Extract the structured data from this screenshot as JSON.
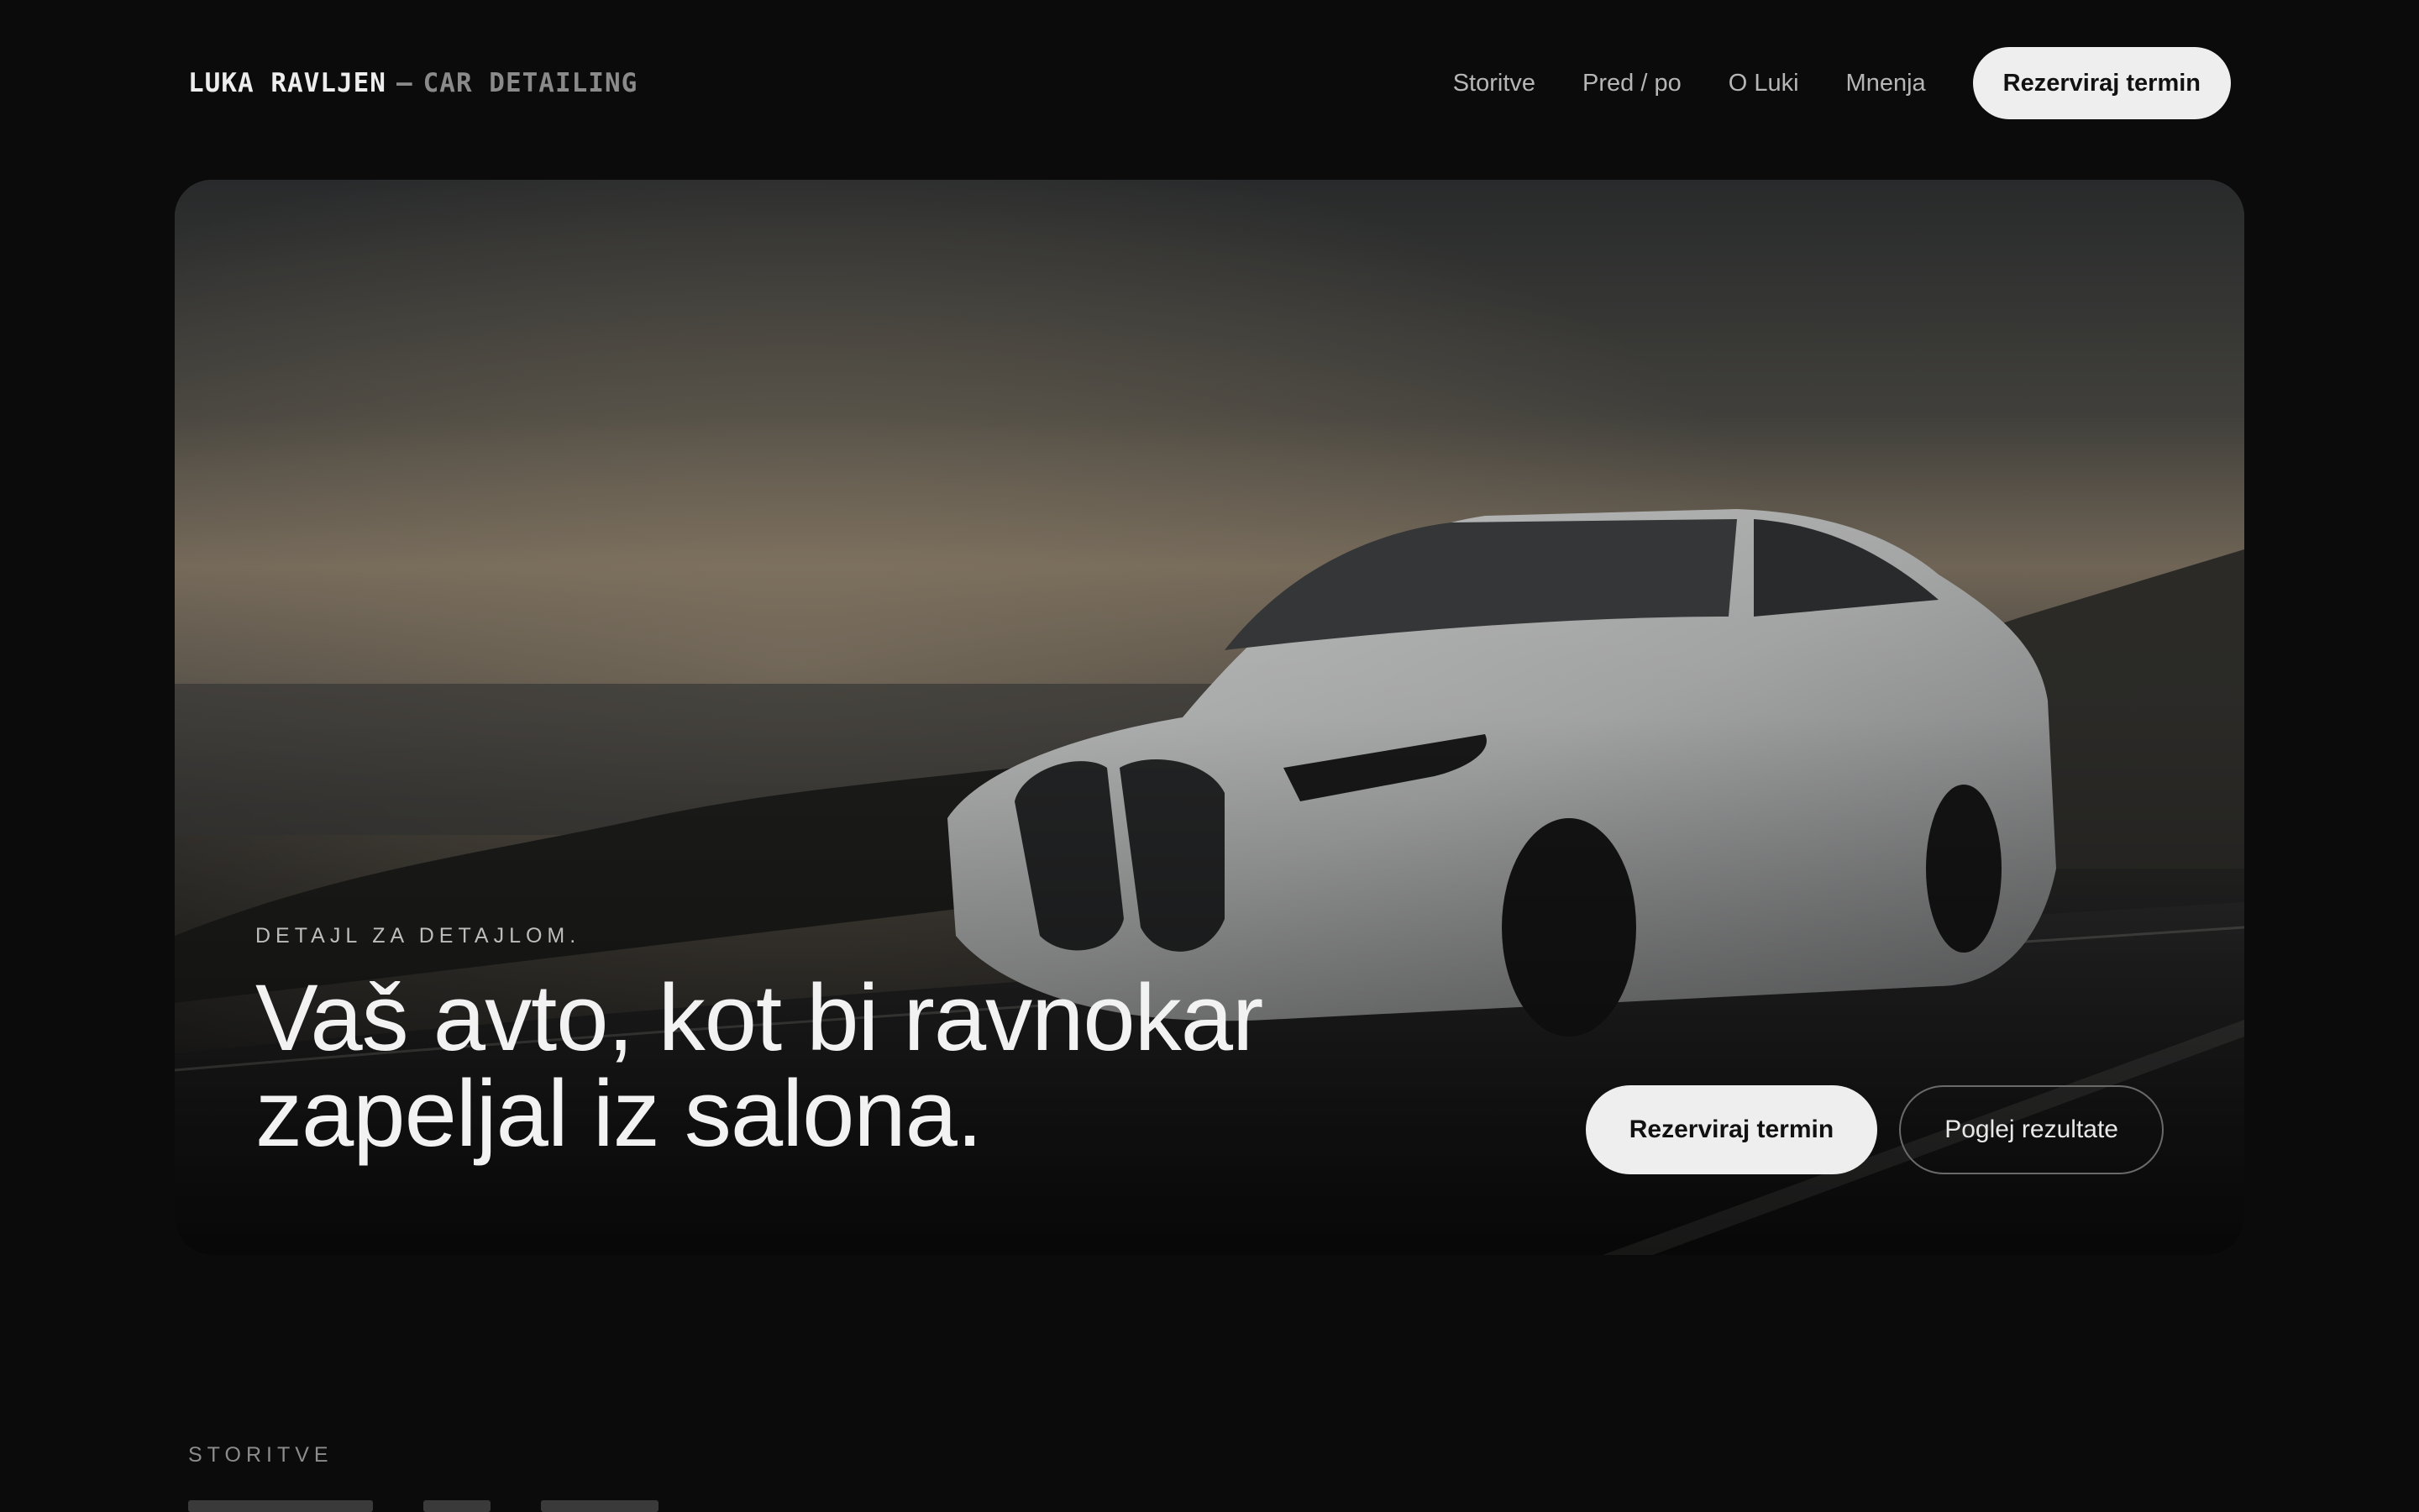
{
  "header": {
    "brand_name": "LUKA RAVLJEN",
    "brand_separator": "—",
    "brand_tagline": "CAR DETAILING",
    "nav": [
      {
        "label": "Storitve"
      },
      {
        "label": "Pred / po"
      },
      {
        "label": "O Luki"
      },
      {
        "label": "Mnenja"
      }
    ],
    "cta_label": "Rezerviraj termin"
  },
  "hero": {
    "eyebrow": "DETAJL ZA DETAJLOM.",
    "headline_line1": "Vaš avto, kot bi ravnokar",
    "headline_line2": "zapeljal iz salona.",
    "primary_button": "Rezerviraj termin",
    "secondary_button": "Poglej rezultate",
    "image_subject": "white-coupe-on-coastal-road"
  },
  "services_section": {
    "label": "STORITVE"
  },
  "colors": {
    "background": "#0b0b0b",
    "text": "#ededed",
    "muted": "#8a8a8a",
    "button_fill": "#eeeeee",
    "button_text": "#111111"
  }
}
